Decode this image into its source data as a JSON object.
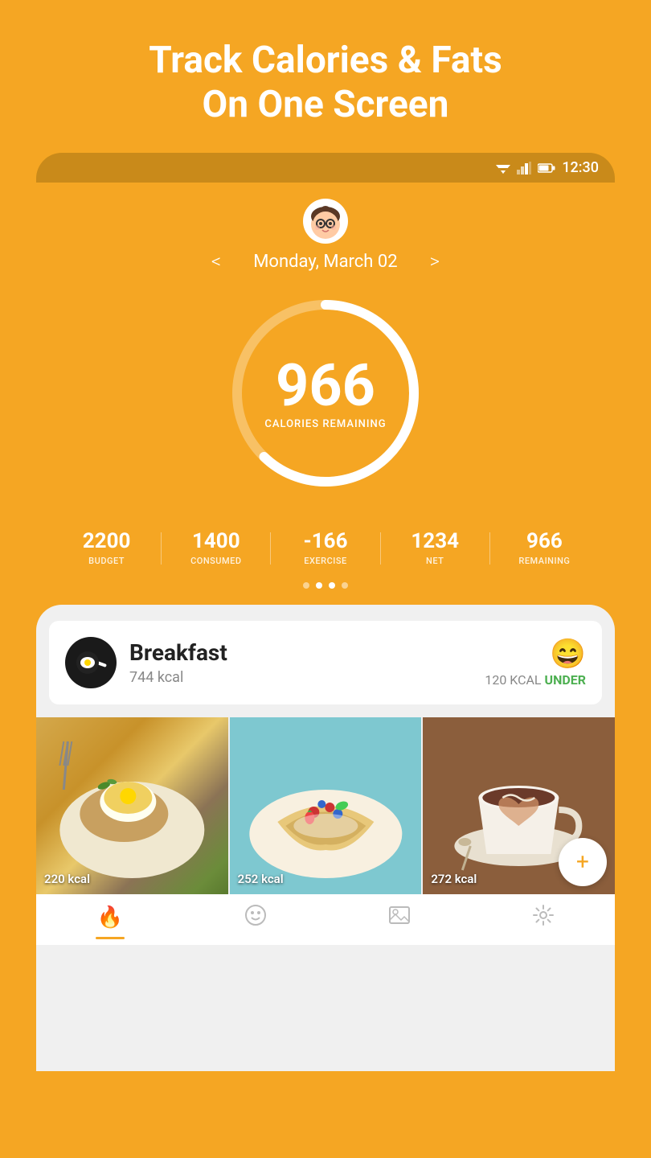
{
  "promo": {
    "title_line1": "Track Calories & Fats",
    "title_line2": "On One Screen"
  },
  "status_bar": {
    "time": "12:30",
    "wifi": "▼",
    "signal": "◢",
    "battery": "▭"
  },
  "date_nav": {
    "prev_label": "<",
    "next_label": ">",
    "current_date": "Monday, March 02"
  },
  "calorie_ring": {
    "remaining_number": "966",
    "remaining_label": "CALORIES REMAINING",
    "progress_percent": 56
  },
  "stats": [
    {
      "value": "2200",
      "label": "BUDGET"
    },
    {
      "value": "1400",
      "label": "CONSUMED"
    },
    {
      "value": "-166",
      "label": "EXERCISE"
    },
    {
      "value": "1234",
      "label": "NET"
    },
    {
      "value": "966",
      "label": "REMAINING"
    }
  ],
  "dots": [
    {
      "active": false
    },
    {
      "active": true
    },
    {
      "active": true
    },
    {
      "active": false
    }
  ],
  "breakfast": {
    "name": "Breakfast",
    "kcal": "744 kcal",
    "emoji": "😄",
    "under_amount": "120 KCAL",
    "under_label": "UNDER"
  },
  "food_items": [
    {
      "kcal": "220 kcal",
      "bg_class": "food-eggs"
    },
    {
      "kcal": "252 kcal",
      "bg_class": "food-crepes"
    },
    {
      "kcal": "272 kcal",
      "bg_class": "food-coffee"
    }
  ],
  "nav_items": [
    {
      "icon": "🔥",
      "label": "calories",
      "active": true
    },
    {
      "icon": "😊",
      "label": "mood",
      "active": false
    },
    {
      "icon": "🖼",
      "label": "gallery",
      "active": false
    },
    {
      "icon": "⚙",
      "label": "settings",
      "active": false
    }
  ],
  "add_button": {
    "label": "+"
  }
}
